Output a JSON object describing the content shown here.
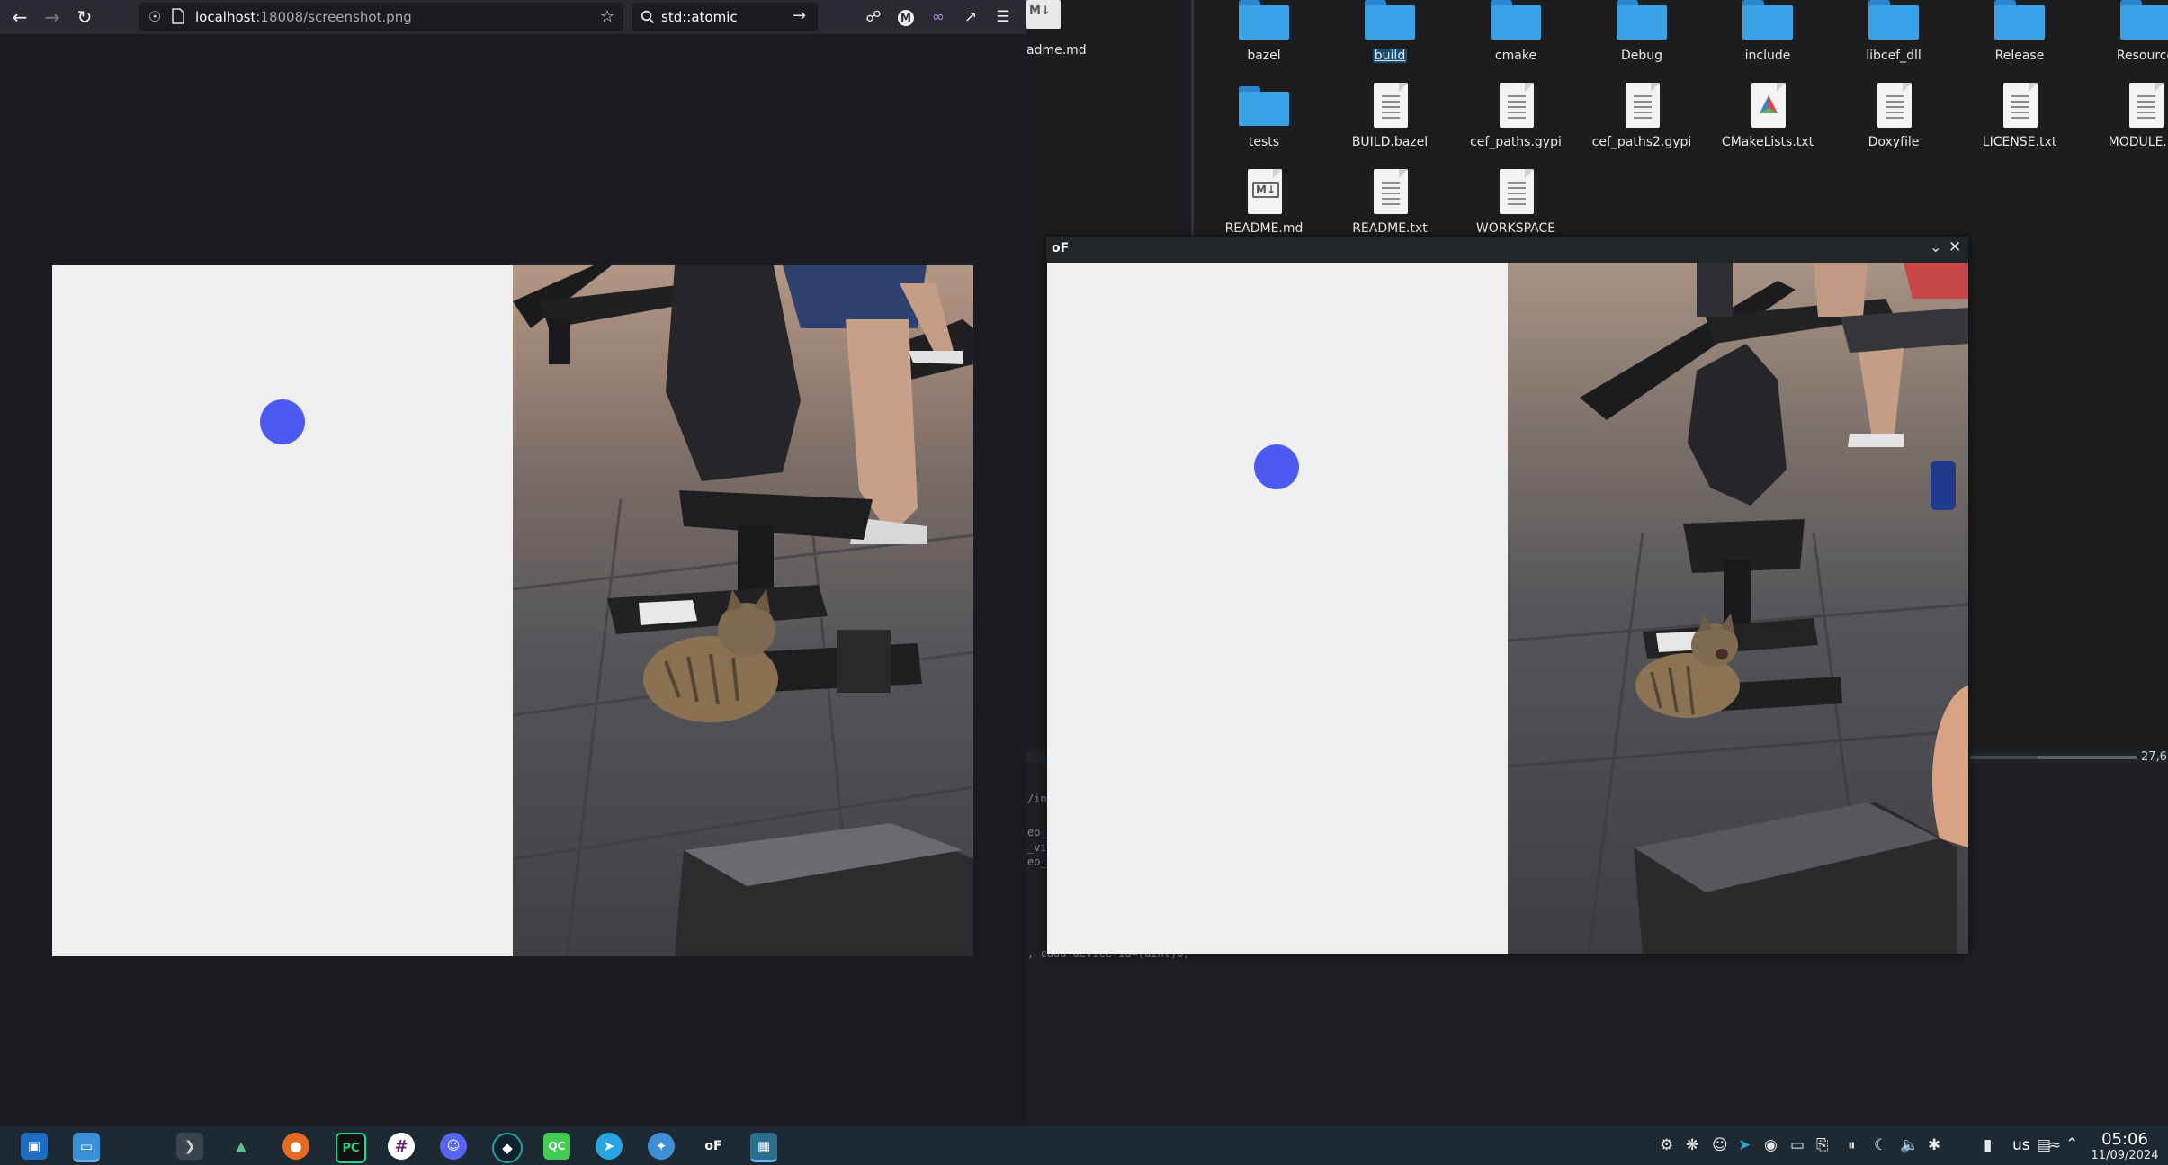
{
  "browser": {
    "url_host": "localhost",
    "url_path": ":18008/screenshot.png",
    "search_text": "std::atomic",
    "nav_icons": [
      "back-arrow-icon",
      "forward-arrow-icon",
      "reload-icon"
    ],
    "toolbar_icons": [
      "pocket-icon",
      "m-extension-icon",
      "extension-icon",
      "share-icon",
      "menu-icon"
    ]
  },
  "file_manager": {
    "partial_item": "adme.md",
    "rows": [
      [
        {
          "name": "bazel",
          "kind": "folder"
        },
        {
          "name": "build",
          "kind": "folder",
          "selected": true
        },
        {
          "name": "cmake",
          "kind": "folder"
        },
        {
          "name": "Debug",
          "kind": "folder"
        },
        {
          "name": "include",
          "kind": "folder"
        },
        {
          "name": "libcef_dll",
          "kind": "folder"
        },
        {
          "name": "Release",
          "kind": "folder"
        },
        {
          "name": "Resource",
          "kind": "folder"
        }
      ],
      [
        {
          "name": "tests",
          "kind": "folder"
        },
        {
          "name": "BUILD.bazel",
          "kind": "text"
        },
        {
          "name": "cef_paths.gypi",
          "kind": "text"
        },
        {
          "name": "cef_paths2.gypi",
          "kind": "text"
        },
        {
          "name": "CMakeLists.txt",
          "kind": "cmake"
        },
        {
          "name": "Doxyfile",
          "kind": "text"
        },
        {
          "name": "LICENSE.txt",
          "kind": "text"
        },
        {
          "name": "MODULE.ba",
          "kind": "text"
        }
      ],
      [
        {
          "name": "README.md",
          "kind": "markdown"
        },
        {
          "name": "README.txt",
          "kind": "text"
        },
        {
          "name": "WORKSPACE",
          "kind": "text"
        }
      ]
    ]
  },
  "terminal": {
    "progress_label": "27,6",
    "lines": [
      "/in",
      "eo_",
      "_vi",
      "eo_",
      ", cuda-device-id=(uint)0,"
    ]
  },
  "window": {
    "logo": "oF",
    "minimize_icon": "chevron-down-icon",
    "close_icon": "close-icon"
  },
  "taskbar": {
    "apps": [
      "app-launcher-icon",
      "file-manager-icon",
      "terminal-icon",
      "system-monitor-icon",
      "firefox-icon",
      "pycharm-icon",
      "slack-icon",
      "discord-icon",
      "vpn-icon",
      "qt-creator-icon",
      "telegram-icon",
      "remmina-icon",
      "openframeworks-icon",
      "screenshot-tool-icon"
    ],
    "keyboard_layout": "us",
    "time": "05:06",
    "date": "11/09/2024"
  },
  "colors": {
    "dot": "#4c5af2",
    "panel_light": "#efefef",
    "folder_blue": "#3ba1e6",
    "taskbar": "#1e2a33"
  }
}
